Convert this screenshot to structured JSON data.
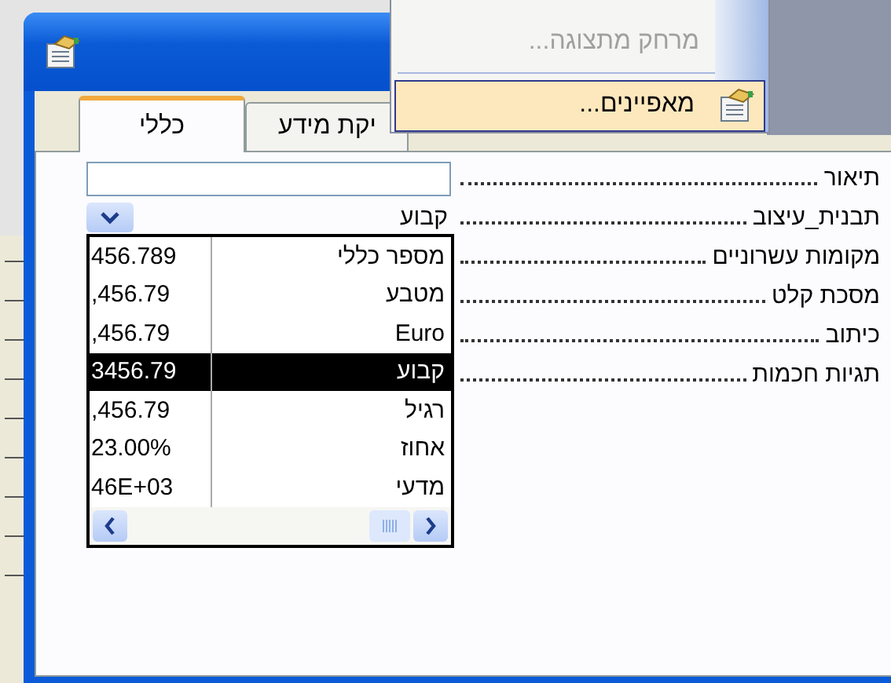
{
  "tabs": [
    {
      "label": "יקת מידע",
      "selected": false
    },
    {
      "label": "כללי",
      "selected": true
    }
  ],
  "properties": [
    {
      "label": "תיאור",
      "kind": "text"
    },
    {
      "label": "תבנית_עיצוב",
      "kind": "combo",
      "value": "קבוע"
    },
    {
      "label": "מקומות עשרוניים",
      "kind": "plain"
    },
    {
      "label": "מסכת קלט",
      "kind": "plain"
    },
    {
      "label": "כיתוב",
      "kind": "plain"
    },
    {
      "label": "תגיות חכמות",
      "kind": "plain"
    }
  ],
  "format_list": {
    "items": [
      {
        "name": "מספר כללי",
        "sample": "456.789",
        "selected": false
      },
      {
        "name": "מטבע",
        "sample": ",456.79",
        "selected": false
      },
      {
        "name": "Euro",
        "sample": ",456.79",
        "selected": false
      },
      {
        "name": "קבוע",
        "sample": "3456.79",
        "selected": true
      },
      {
        "name": "רגיל",
        "sample": ",456.79",
        "selected": false
      },
      {
        "name": "אחוז",
        "sample": "23.00%",
        "selected": false
      },
      {
        "name": "מדעי",
        "sample": "46E+03",
        "selected": false
      }
    ]
  },
  "context_menu": {
    "items": [
      {
        "label": "מרחק מתצוגה...",
        "disabled": true,
        "selected": false
      },
      {
        "label": "מאפיינים...",
        "disabled": false,
        "selected": true
      }
    ]
  }
}
